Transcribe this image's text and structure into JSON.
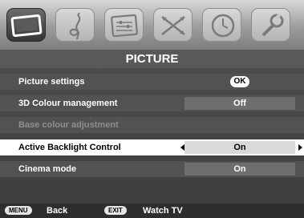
{
  "icon_tabs": [
    {
      "name": "picture-icon",
      "active": true
    },
    {
      "name": "sound-icon",
      "active": false
    },
    {
      "name": "preferences-icon",
      "active": false
    },
    {
      "name": "setup-icon",
      "active": false
    },
    {
      "name": "timer-icon",
      "active": false
    },
    {
      "name": "settings-icon",
      "active": false
    }
  ],
  "menu": {
    "title": "PICTURE",
    "rows": [
      {
        "label": "Picture settings",
        "value": "OK",
        "state": "normal"
      },
      {
        "label": "3D Colour management",
        "value": "Off",
        "state": "normal"
      },
      {
        "label": "Base colour adjustment",
        "value": "",
        "state": "disabled"
      },
      {
        "label": "Active Backlight Control",
        "value": "On",
        "state": "selected"
      },
      {
        "label": "Cinema mode",
        "value": "On",
        "state": "normal"
      }
    ]
  },
  "footer": {
    "menu_key": "MENU",
    "menu_label": "Back",
    "exit_key": "EXIT",
    "exit_label": "Watch TV"
  },
  "colors": {
    "selected_row": "#ffffff",
    "row_background": "#525252",
    "disabled_text": "#8e8e8e"
  }
}
